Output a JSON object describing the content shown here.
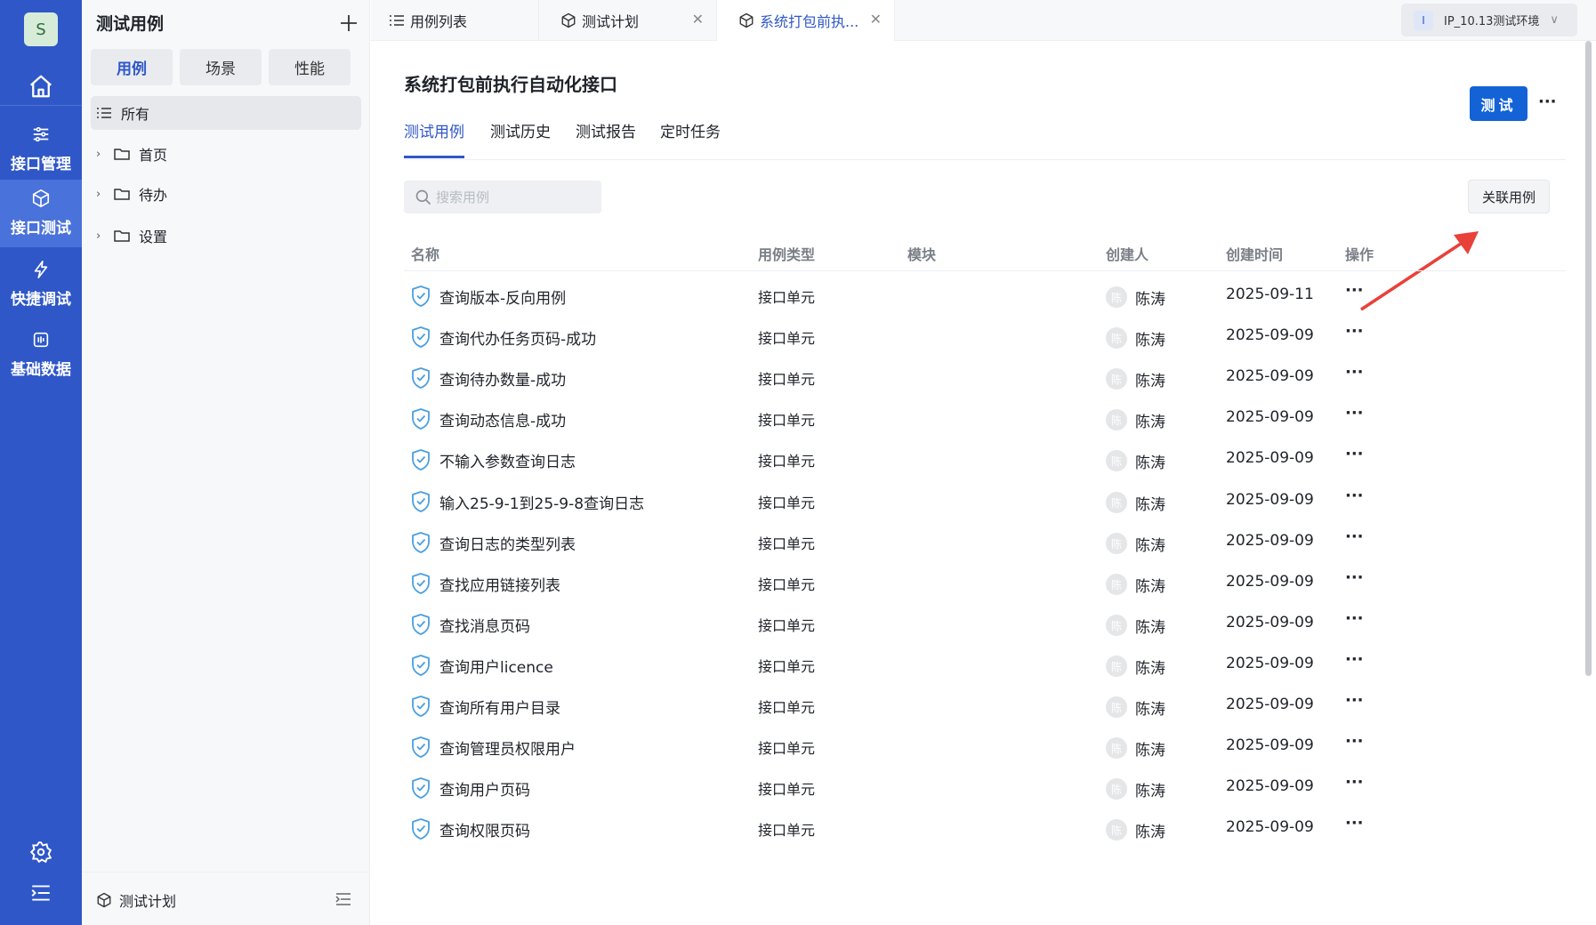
{
  "rail": {
    "avatar": "S",
    "items": [
      {
        "label": "接口管理",
        "icon": "sliders-icon"
      },
      {
        "label": "接口测试",
        "icon": "cube-icon"
      },
      {
        "label": "快捷调试",
        "icon": "lightning-icon"
      },
      {
        "label": "基础数据",
        "icon": "data-icon"
      }
    ]
  },
  "tree": {
    "title": "测试用例",
    "segments": [
      "用例",
      "场景",
      "性能"
    ],
    "nodes": [
      "所有",
      "首页",
      "待办",
      "设置"
    ],
    "footer": "测试计划"
  },
  "tabs": [
    {
      "label": "用例列表"
    },
    {
      "label": "测试计划"
    },
    {
      "label": "系统打包前执..."
    }
  ],
  "env": {
    "icon_text": "I",
    "label": "IP_10.13测试环境"
  },
  "page": {
    "title": "系统打包前执行自动化接口",
    "test_button": "测试",
    "more": "···",
    "subtabs": [
      "测试用例",
      "测试历史",
      "测试报告",
      "定时任务"
    ],
    "search_placeholder": "搜索用例",
    "link_button": "关联用例"
  },
  "table": {
    "headers": [
      "名称",
      "用例类型",
      "模块",
      "创建人",
      "创建时间",
      "操作"
    ],
    "rows": [
      {
        "name": "查询版本-反向用例",
        "type": "接口单元",
        "avatar": "陈",
        "creator": "陈涛",
        "date": "2025-09-11",
        "op": "···"
      },
      {
        "name": "查询代办任务页码-成功",
        "type": "接口单元",
        "avatar": "陈",
        "creator": "陈涛",
        "date": "2025-09-09",
        "op": "···"
      },
      {
        "name": "查询待办数量-成功",
        "type": "接口单元",
        "avatar": "陈",
        "creator": "陈涛",
        "date": "2025-09-09",
        "op": "···"
      },
      {
        "name": "查询动态信息-成功",
        "type": "接口单元",
        "avatar": "陈",
        "creator": "陈涛",
        "date": "2025-09-09",
        "op": "···"
      },
      {
        "name": "不输入参数查询日志",
        "type": "接口单元",
        "avatar": "陈",
        "creator": "陈涛",
        "date": "2025-09-09",
        "op": "···"
      },
      {
        "name": "输入25-9-1到25-9-8查询日志",
        "type": "接口单元",
        "avatar": "陈",
        "creator": "陈涛",
        "date": "2025-09-09",
        "op": "···"
      },
      {
        "name": "查询日志的类型列表",
        "type": "接口单元",
        "avatar": "陈",
        "creator": "陈涛",
        "date": "2025-09-09",
        "op": "···"
      },
      {
        "name": "查找应用链接列表",
        "type": "接口单元",
        "avatar": "陈",
        "creator": "陈涛",
        "date": "2025-09-09",
        "op": "···"
      },
      {
        "name": "查找消息页码",
        "type": "接口单元",
        "avatar": "陈",
        "creator": "陈涛",
        "date": "2025-09-09",
        "op": "···"
      },
      {
        "name": "查询用户licence",
        "type": "接口单元",
        "avatar": "陈",
        "creator": "陈涛",
        "date": "2025-09-09",
        "op": "···"
      },
      {
        "name": "查询所有用户目录",
        "type": "接口单元",
        "avatar": "陈",
        "creator": "陈涛",
        "date": "2025-09-09",
        "op": "···"
      },
      {
        "name": "查询管理员权限用户",
        "type": "接口单元",
        "avatar": "陈",
        "creator": "陈涛",
        "date": "2025-09-09",
        "op": "···"
      },
      {
        "name": "查询用户页码",
        "type": "接口单元",
        "avatar": "陈",
        "creator": "陈涛",
        "date": "2025-09-09",
        "op": "···"
      },
      {
        "name": "查询权限页码",
        "type": "接口单元",
        "avatar": "陈",
        "creator": "陈涛",
        "date": "2025-09-09",
        "op": "···"
      }
    ]
  },
  "colors": {
    "brand": "#2f57c8",
    "primary_button": "#1363d6",
    "annotation_arrow": "#e8413a",
    "shield": "#4a9fe0"
  }
}
